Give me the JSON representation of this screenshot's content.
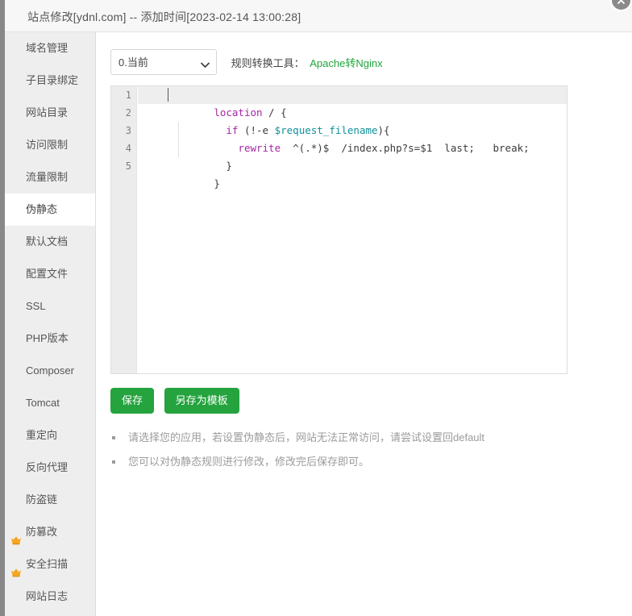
{
  "window": {
    "title": "站点修改[ydnl.com] -- 添加时间[2023-02-14 13:00:28]",
    "close_icon": "close-icon"
  },
  "sidebar": {
    "items": [
      {
        "label": "域名管理",
        "icon": null,
        "active": false
      },
      {
        "label": "子目录绑定",
        "icon": null,
        "active": false
      },
      {
        "label": "网站目录",
        "icon": null,
        "active": false
      },
      {
        "label": "访问限制",
        "icon": null,
        "active": false
      },
      {
        "label": "流量限制",
        "icon": null,
        "active": false
      },
      {
        "label": "伪静态",
        "icon": null,
        "active": true
      },
      {
        "label": "默认文档",
        "icon": null,
        "active": false
      },
      {
        "label": "配置文件",
        "icon": null,
        "active": false
      },
      {
        "label": "SSL",
        "icon": null,
        "active": false
      },
      {
        "label": "PHP版本",
        "icon": null,
        "active": false
      },
      {
        "label": "Composer",
        "icon": null,
        "active": false
      },
      {
        "label": "Tomcat",
        "icon": null,
        "active": false
      },
      {
        "label": "重定向",
        "icon": null,
        "active": false
      },
      {
        "label": "反向代理",
        "icon": null,
        "active": false
      },
      {
        "label": "防盗链",
        "icon": null,
        "active": false
      },
      {
        "label": "防篡改",
        "icon": "crown-icon",
        "active": false
      },
      {
        "label": "安全扫描",
        "icon": "crown-icon",
        "active": false
      },
      {
        "label": "网站日志",
        "icon": null,
        "active": false
      }
    ]
  },
  "toolbar": {
    "select_value": "0.当前",
    "select_options": [
      "0.当前"
    ],
    "chevron_icon": "chevron-down-icon",
    "convert_label": "规则转换工具：",
    "convert_link": "Apache转Nginx",
    "link_color": "#20a53a"
  },
  "editor": {
    "line_numbers": [
      "1",
      "2",
      "3",
      "4",
      "5"
    ],
    "lines": [
      {
        "tokens": [
          {
            "t": "location",
            "c": "kw"
          },
          {
            "t": " / {",
            "c": "plain"
          }
        ]
      },
      {
        "tokens": [
          {
            "t": "  ",
            "c": "plain"
          },
          {
            "t": "if",
            "c": "kw"
          },
          {
            "t": " (!-e ",
            "c": "plain"
          },
          {
            "t": "$request_filename",
            "c": "var"
          },
          {
            "t": "){",
            "c": "plain"
          }
        ]
      },
      {
        "tokens": [
          {
            "t": "    ",
            "c": "plain"
          },
          {
            "t": "rewrite",
            "c": "kw"
          },
          {
            "t": "  ^(.*)$  /index.php?s=$1  last;   break;",
            "c": "plain"
          }
        ]
      },
      {
        "tokens": [
          {
            "t": "  }",
            "c": "plain"
          }
        ]
      },
      {
        "tokens": [
          {
            "t": "}",
            "c": "plain"
          }
        ]
      }
    ],
    "plain_text": "location / {\n  if (!-e $request_filename){\n    rewrite  ^(.*)$  /index.php?s=$1  last;   break;\n  }\n}"
  },
  "buttons": {
    "save": "保存",
    "save_as_template": "另存为模板",
    "color": "#25a33e"
  },
  "hints": [
    "请选择您的应用，若设置伪静态后，网站无法正常访问，请尝试设置回default",
    "您可以对伪静态规则进行修改，修改完后保存即可。"
  ]
}
